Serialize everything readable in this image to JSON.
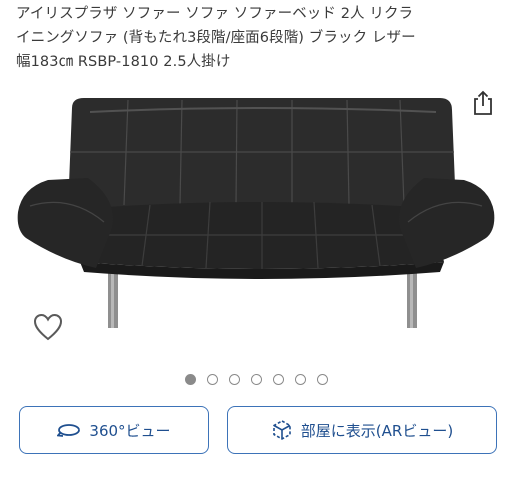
{
  "product": {
    "title_lines": [
      "アイリスプラザ ソファー ソファ ソファーベッド 2人 リクラ",
      "イニングソファ (背もたれ3段階/座面6段階) ブラック レザー",
      "幅183㎝ RSBP-1810 2.5人掛け"
    ]
  },
  "gallery": {
    "image_count": 7,
    "active_index": 0
  },
  "buttons": {
    "view360_label": "360°ビュー",
    "ar_label": "部屋に表示(ARビュー)"
  },
  "icons": {
    "share": "share-icon",
    "wishlist": "heart-icon",
    "rotate": "rotate-360-icon",
    "ar": "ar-cube-icon"
  },
  "colors": {
    "accent": "#3d73b8",
    "dot": "#8a8a8a",
    "sofa": "#262626"
  }
}
